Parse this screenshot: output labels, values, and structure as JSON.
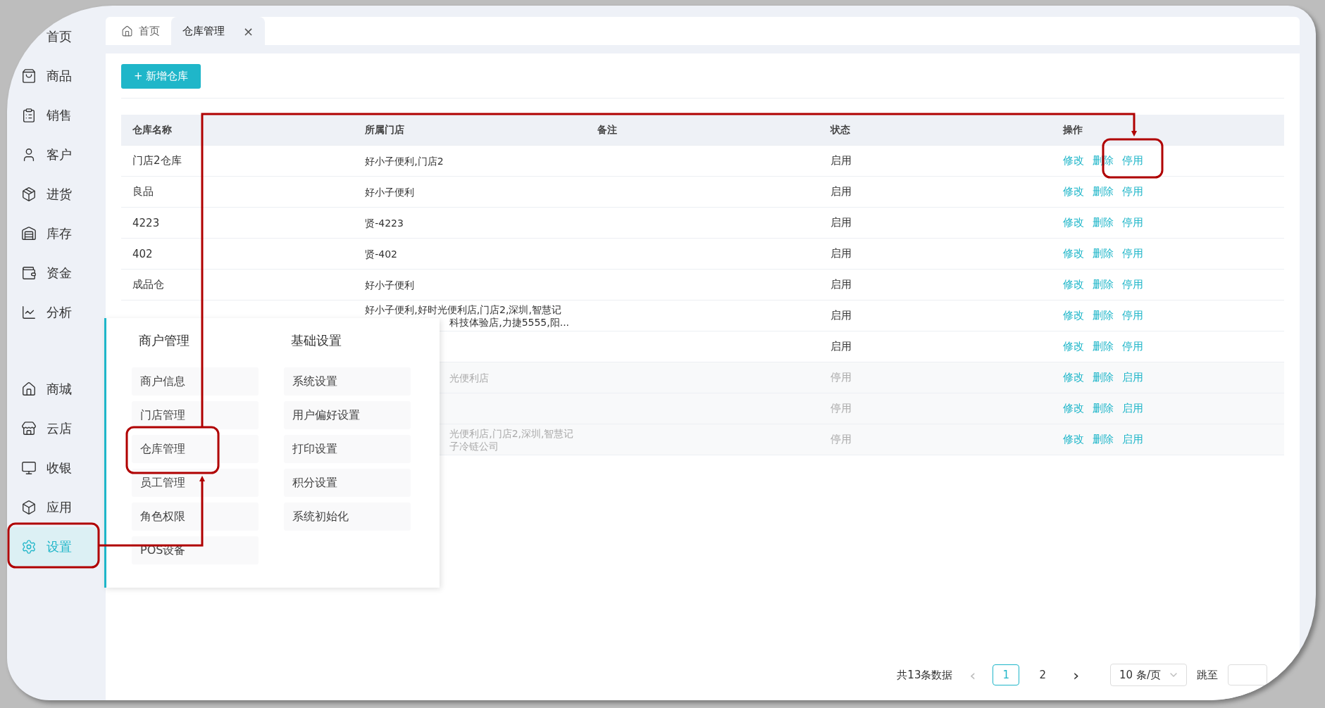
{
  "sidebar": {
    "main_items": [
      {
        "label": "首页",
        "selected": false
      },
      {
        "label": "商品",
        "selected": false
      },
      {
        "label": "销售",
        "selected": false
      },
      {
        "label": "客户",
        "selected": false
      },
      {
        "label": "进货",
        "selected": false
      },
      {
        "label": "库存",
        "selected": false
      },
      {
        "label": "资金",
        "selected": false
      },
      {
        "label": "分析",
        "selected": false
      }
    ],
    "app_items": [
      {
        "label": "商城",
        "selected": false
      },
      {
        "label": "云店",
        "selected": false
      },
      {
        "label": "收银",
        "selected": false
      },
      {
        "label": "应用",
        "selected": false
      },
      {
        "label": "设置",
        "selected": true
      }
    ]
  },
  "tabs": [
    {
      "label": "首页",
      "selected": false
    },
    {
      "label": "仓库管理",
      "close": "×",
      "selected": true
    }
  ],
  "add_button": {
    "icon": "+",
    "label": "新增仓库"
  },
  "table": {
    "columns": [
      "仓库名称",
      "所属门店",
      "备注",
      "状态",
      "操作"
    ],
    "rows": [
      {
        "name": "门店2仓库",
        "store": [
          {
            "text": "好小子便利,门店2",
            "clipped": false
          }
        ],
        "status": "启用",
        "enabled": true,
        "actions": [
          "修改",
          "删除",
          "停用"
        ]
      },
      {
        "name": "良品",
        "store": [
          {
            "text": "好小子便利",
            "clipped": false
          }
        ],
        "status": "启用",
        "enabled": true,
        "actions": [
          "修改",
          "删除",
          "停用"
        ]
      },
      {
        "name": "4223",
        "store": [
          {
            "text": "贤-4223",
            "clipped": false
          }
        ],
        "status": "启用",
        "enabled": true,
        "actions": [
          "修改",
          "删除",
          "停用"
        ]
      },
      {
        "name": "402",
        "store": [
          {
            "text": "贤-402",
            "clipped": false
          }
        ],
        "status": "启用",
        "enabled": true,
        "actions": [
          "修改",
          "删除",
          "停用"
        ]
      },
      {
        "name": "成品仓",
        "store": [
          {
            "text": "好小子便利",
            "clipped": false
          }
        ],
        "status": "启用",
        "enabled": true,
        "actions": [
          "修改",
          "删除",
          "停用"
        ]
      },
      {
        "store": [
          {
            "text": "好小子便利,好时光便利店,门店2,深圳,智慧记",
            "clipped": false
          },
          {
            "text": "科技体验店,力捷5555,阳...",
            "clipped": true
          }
        ],
        "status": "启用",
        "enabled": true,
        "actions": [
          "修改",
          "删除",
          "停用"
        ]
      },
      {
        "store": [],
        "status": "启用",
        "enabled": true,
        "actions": [
          "修改",
          "删除",
          "停用"
        ]
      },
      {
        "store": [
          {
            "text": "光便利店",
            "clipped": true
          }
        ],
        "status": "停用",
        "enabled": false,
        "actions": [
          "修改",
          "删除",
          "启用"
        ]
      },
      {
        "store": [],
        "status": "停用",
        "enabled": false,
        "actions": [
          "修改",
          "删除",
          "启用"
        ]
      },
      {
        "store": [
          {
            "text": "光便利店,门店2,深圳,智慧记",
            "clipped": true
          },
          {
            "text": "子冷链公司",
            "clipped": true
          }
        ],
        "status": "停用",
        "enabled": false,
        "actions": [
          "修改",
          "删除",
          "启用"
        ]
      }
    ]
  },
  "settings_menu": {
    "groups": [
      {
        "title": "商户管理",
        "items": [
          "商户信息",
          "门店管理",
          "仓库管理",
          "员工管理",
          "角色权限",
          "POS设备"
        ]
      },
      {
        "title": "基础设置",
        "items": [
          "系统设置",
          "用户偏好设置",
          "打印设置",
          "积分设置",
          "系统初始化"
        ]
      }
    ]
  },
  "pagination": {
    "total": "共13条数据",
    "prev": "‹",
    "pages": [
      {
        "label": "1",
        "selected": true
      },
      {
        "label": "2",
        "selected": false
      }
    ],
    "next": "›",
    "page_size": "10 条/页",
    "jump_label": "跳至"
  }
}
